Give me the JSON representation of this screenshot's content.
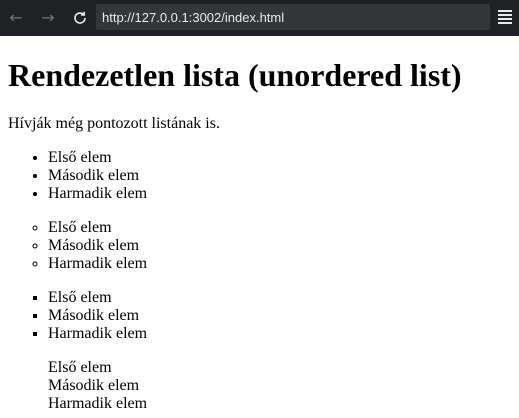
{
  "browser": {
    "url": "http://127.0.0.1:3002/index.html",
    "icons": {
      "back": "arrow-left-icon",
      "forward": "arrow-right-icon",
      "reload": "reload-icon",
      "menu": "hamburger-menu-icon"
    }
  },
  "page": {
    "title": "Rendezetlen lista (unordered list)",
    "intro": "Hívják még pontozott listának is.",
    "lists": [
      {
        "style": "disc",
        "items": [
          "Első elem",
          "Második elem",
          "Harmadik elem"
        ]
      },
      {
        "style": "circle",
        "items": [
          "Első elem",
          "Második elem",
          "Harmadik elem"
        ]
      },
      {
        "style": "square",
        "items": [
          "Első elem",
          "Második elem",
          "Harmadik elem"
        ]
      },
      {
        "style": "none",
        "items": [
          "Első elem",
          "Második elem",
          "Harmadik elem"
        ]
      }
    ]
  }
}
